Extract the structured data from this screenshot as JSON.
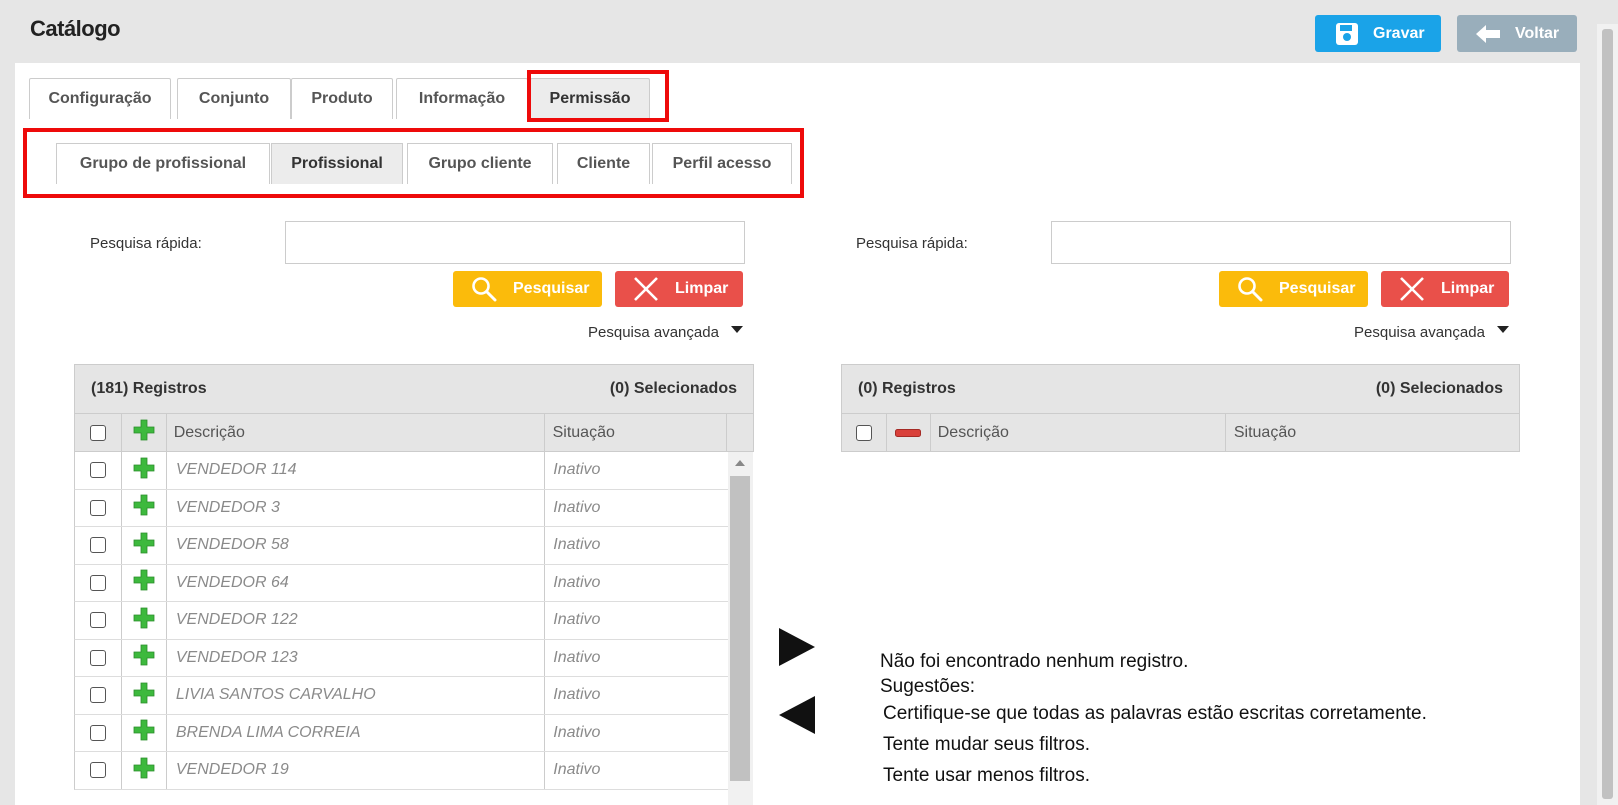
{
  "header": {
    "title": "Catálogo",
    "save_label": "Gravar",
    "back_label": "Voltar"
  },
  "tabs": [
    {
      "label": "Configuração"
    },
    {
      "label": "Conjunto"
    },
    {
      "label": "Produto"
    },
    {
      "label": "Informação"
    },
    {
      "label": "Permissão",
      "active": true
    }
  ],
  "subtabs": [
    {
      "label": "Grupo de profissional"
    },
    {
      "label": "Profissional",
      "active": true
    },
    {
      "label": "Grupo cliente"
    },
    {
      "label": "Cliente"
    },
    {
      "label": "Perfil acesso"
    }
  ],
  "left": {
    "search_label": "Pesquisa rápida:",
    "search_value": "",
    "search_button": "Pesquisar",
    "clear_button": "Limpar",
    "advanced_label": "Pesquisa avançada",
    "records_label": "(181) Registros",
    "selected_label": "(0) Selecionados",
    "columns": [
      "Descrição",
      "Situação"
    ],
    "rows": [
      {
        "descricao": "VENDEDOR 114",
        "situacao": "Inativo"
      },
      {
        "descricao": "VENDEDOR 3",
        "situacao": "Inativo"
      },
      {
        "descricao": "VENDEDOR 58",
        "situacao": "Inativo"
      },
      {
        "descricao": "VENDEDOR 64",
        "situacao": "Inativo"
      },
      {
        "descricao": "VENDEDOR 122",
        "situacao": "Inativo"
      },
      {
        "descricao": "VENDEDOR 123",
        "situacao": "Inativo"
      },
      {
        "descricao": "LIVIA SANTOS CARVALHO",
        "situacao": "Inativo"
      },
      {
        "descricao": "BRENDA LIMA CORREIA",
        "situacao": "Inativo"
      },
      {
        "descricao": "VENDEDOR 19",
        "situacao": "Inativo"
      }
    ]
  },
  "right": {
    "search_label": "Pesquisa rápida:",
    "search_value": "",
    "search_button": "Pesquisar",
    "clear_button": "Limpar",
    "advanced_label": "Pesquisa avançada",
    "records_label": "(0) Registros",
    "selected_label": "(0) Selecionados",
    "columns": [
      "Descrição",
      "Situação"
    ],
    "empty_message": "Não foi encontrado nenhum registro.",
    "suggestions_title": "Sugestões:",
    "suggestions": [
      "Certifique-se que todas as palavras estão escritas corretamente.",
      "Tente mudar seus filtros.",
      "Tente usar menos filtros."
    ]
  },
  "colors": {
    "save": "#1aa3e8",
    "back": "#99aebb",
    "search": "#fbbb0b",
    "clear": "#e9504a",
    "highlight": "#ee0a0a",
    "add_icon": "#3db93d",
    "remove_icon": "#d9403a"
  }
}
